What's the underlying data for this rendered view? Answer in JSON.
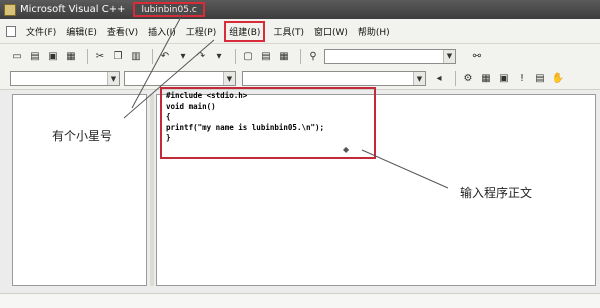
{
  "titlebar": {
    "app_title": "Microsoft Visual C++",
    "project_tab": "lubinbin05.c"
  },
  "menubar": {
    "items": [
      {
        "label": "文件(F)"
      },
      {
        "label": "编辑(E)"
      },
      {
        "label": "查看(V)"
      },
      {
        "label": "插入(I)"
      },
      {
        "label": "工程(P)"
      },
      {
        "label": "组建(B)"
      },
      {
        "label": "工具(T)"
      },
      {
        "label": "窗口(W)"
      },
      {
        "label": "帮助(H)"
      }
    ]
  },
  "editor": {
    "code_lines": [
      "#include <stdio.h>",
      "void main()",
      "{",
      "printf(\"my name is lubinbin05.\\n\");",
      "}"
    ]
  },
  "annotations": {
    "star_note": "有个小星号",
    "code_note": "输入程序正文"
  },
  "colors": {
    "highlight_border": "#d92c3a",
    "titlebar": "#4a4a4a"
  }
}
